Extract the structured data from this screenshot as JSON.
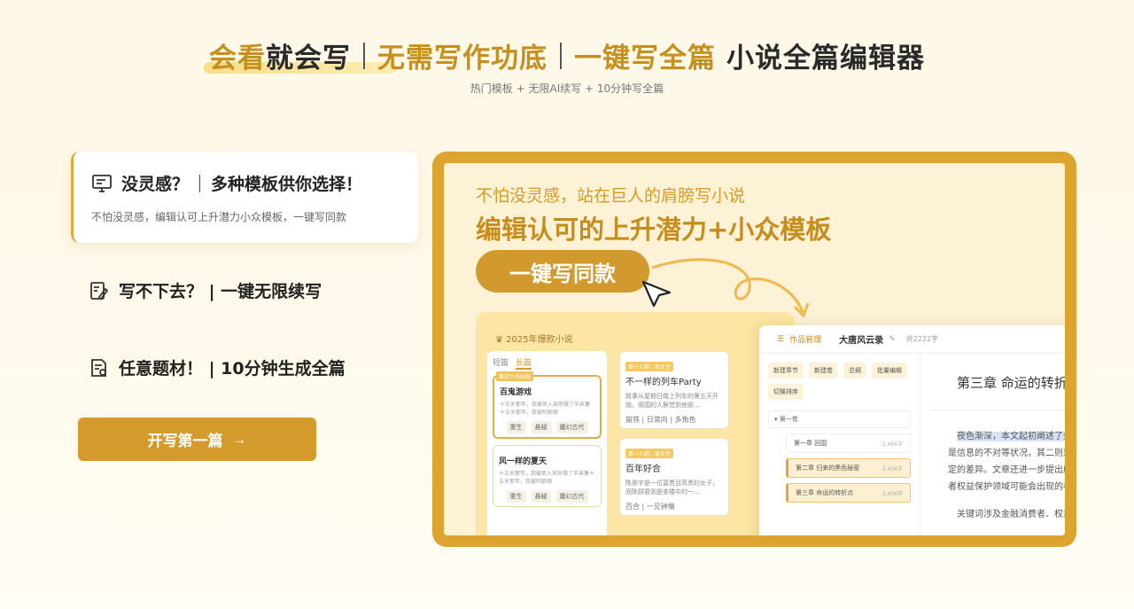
{
  "hero": {
    "part1_gold": "会看",
    "part1_dark": "就会写",
    "part2_gold": "无需写作功底",
    "part3_gold": "一键写全篇",
    "part3_dark": "小说全篇编辑器",
    "subline": "热门模板 + 无限AI续写 + 10分钟写全篇"
  },
  "features": {
    "active": {
      "title_a": "没灵感？",
      "title_b": "多种模板供你选择！",
      "desc": "不怕没灵感，编辑认可上升潜力小众模板，一键写同款",
      "icon": "monitor-icon"
    },
    "item2": {
      "title": "写不下去？ | 一键无限续写",
      "icon": "edit-icon"
    },
    "item3": {
      "title": "任意题材！ | 10分钟生成全篇",
      "icon": "document-icon"
    }
  },
  "cta": {
    "label": "开写第一篇",
    "arrow": "→"
  },
  "showcase": {
    "subtitle": "不怕没灵感，站在巨人的肩膀写小说",
    "title": "编辑认可的上升潜力+小众模板",
    "pill": "一键写同款",
    "template_panel": {
      "header": "2025年爆款小说",
      "tabs": [
        "短篇",
        "长篇"
      ],
      "cards": [
        {
          "badge": "番茄大热出版",
          "title": "百鬼游戏",
          "desc": "十五岁那年，我被卖入宋府做了半床妻十五岁那年，我被阿娘顿",
          "tags": [
            "重生",
            "悬疑",
            "魔幻古代"
          ]
        },
        {
          "badge": "",
          "title": "风一样的夏天",
          "desc": "十五岁那年，我被卖入宋府做了半床妻十五岁那年，我被阿娘顿",
          "tags": [
            "重生",
            "悬疑",
            "魔幻古代"
          ]
        }
      ],
      "books": [
        {
          "badge": "第一人称，男女主",
          "title": "不一样的列车Party",
          "desc": "故事从星期日踏上列车的第五天开始，雨围的人察觉到他依…",
          "genre": "崩铁 | 日常向 | 多角色"
        },
        {
          "badge": "第一人称，双女主",
          "title": "百年好合",
          "desc": "陈昊宇是一位富贵且高贵的女子，而陈顾君则是茶楼中的一…",
          "genre": "百合 | 一见钟情"
        }
      ]
    },
    "editor": {
      "nav_label": "作品管理",
      "book_name": "大唐风云录",
      "word_count": "共2222字",
      "buttons": [
        "新建章节",
        "新建卷",
        "总纲",
        "批量编辑",
        "切换排序"
      ],
      "volume": "第一卷",
      "chapters": [
        {
          "title": "第一章 回国",
          "count": "2,456字",
          "active": false
        },
        {
          "title": "第二章 归来的黑色秘密",
          "count": "2,456字",
          "active": true
        },
        {
          "title": "第三章 命运的转折点",
          "count": "2,456字",
          "active": true
        }
      ],
      "chapter_heading": "第三章 命运的转折点",
      "para_highlight": "夜色渐深，本文起初阐述了金",
      "para_lines": [
        "是信息的不对等状况，其二则是",
        "定的差异。文章还进一步提出应",
        "者权益保护领域可能会出现的机"
      ],
      "para2": "关键词涉及金融消费者、权益"
    }
  }
}
